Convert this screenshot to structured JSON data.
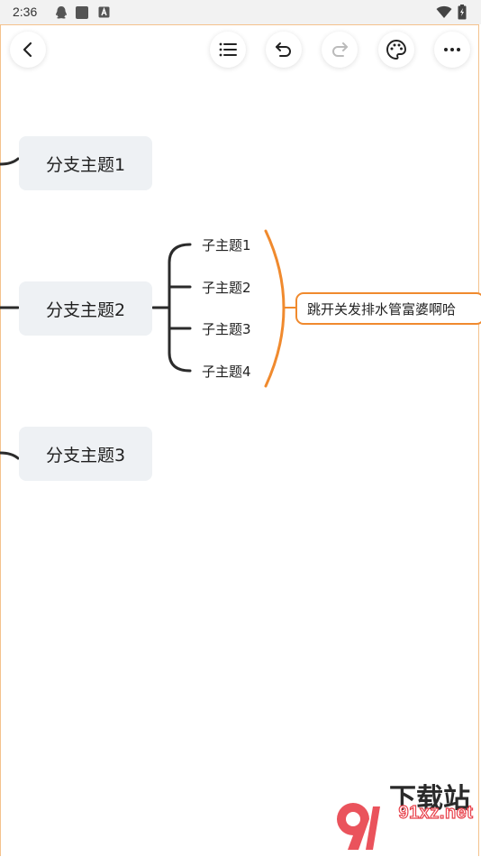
{
  "status_bar": {
    "time": "2:36",
    "icons": [
      "qq-icon",
      "app-square-icon",
      "keyboard-a-icon",
      "wifi-icon",
      "battery-charging-icon"
    ]
  },
  "toolbar": {
    "buttons": [
      "back-icon",
      "outline-list-icon",
      "undo-icon",
      "redo-icon",
      "palette-icon",
      "more-icon"
    ]
  },
  "mindmap": {
    "branches": [
      {
        "label": "分支主题1"
      },
      {
        "label": "分支主题2"
      },
      {
        "label": "分支主题3"
      }
    ],
    "subtopics": [
      "子主题1",
      "子主题2",
      "子主题3",
      "子主题4"
    ],
    "summary": "跳开关发排水管富婆啊哈"
  },
  "watermark": {
    "title": "下载站",
    "site": "91xz.net"
  },
  "colors": {
    "accent": "#f08a2e",
    "branch_bg": "#eef1f4",
    "line": "#2b2b2b"
  }
}
